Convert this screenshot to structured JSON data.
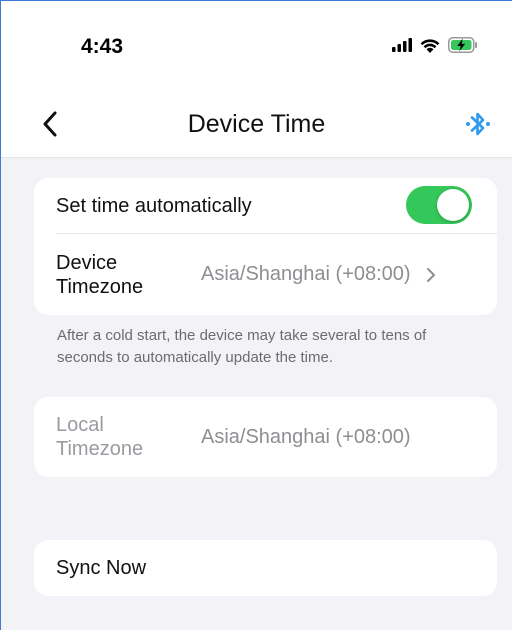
{
  "status_bar": {
    "time": "4:43",
    "icons": [
      "signal-icon",
      "wifi-icon",
      "battery-charging-icon"
    ]
  },
  "nav": {
    "title": "Device Time",
    "back_icon": "chevron-left-icon",
    "bluetooth_icon": "bluetooth-icon",
    "accent_color": "#2f9bf0"
  },
  "settings": {
    "auto_time": {
      "label": "Set time automatically",
      "enabled": true,
      "toggle_color": "#34c759"
    },
    "device_timezone": {
      "label": "Device\nTimezone",
      "value": "Asia/Shanghai (+08:00)"
    },
    "note": "After a cold start, the device may take several to tens of seconds to automatically update the time.",
    "local_timezone": {
      "label": "Local\nTimezone",
      "value": "Asia/Shanghai (+08:00)"
    },
    "sync": {
      "label": "Sync Now"
    }
  }
}
